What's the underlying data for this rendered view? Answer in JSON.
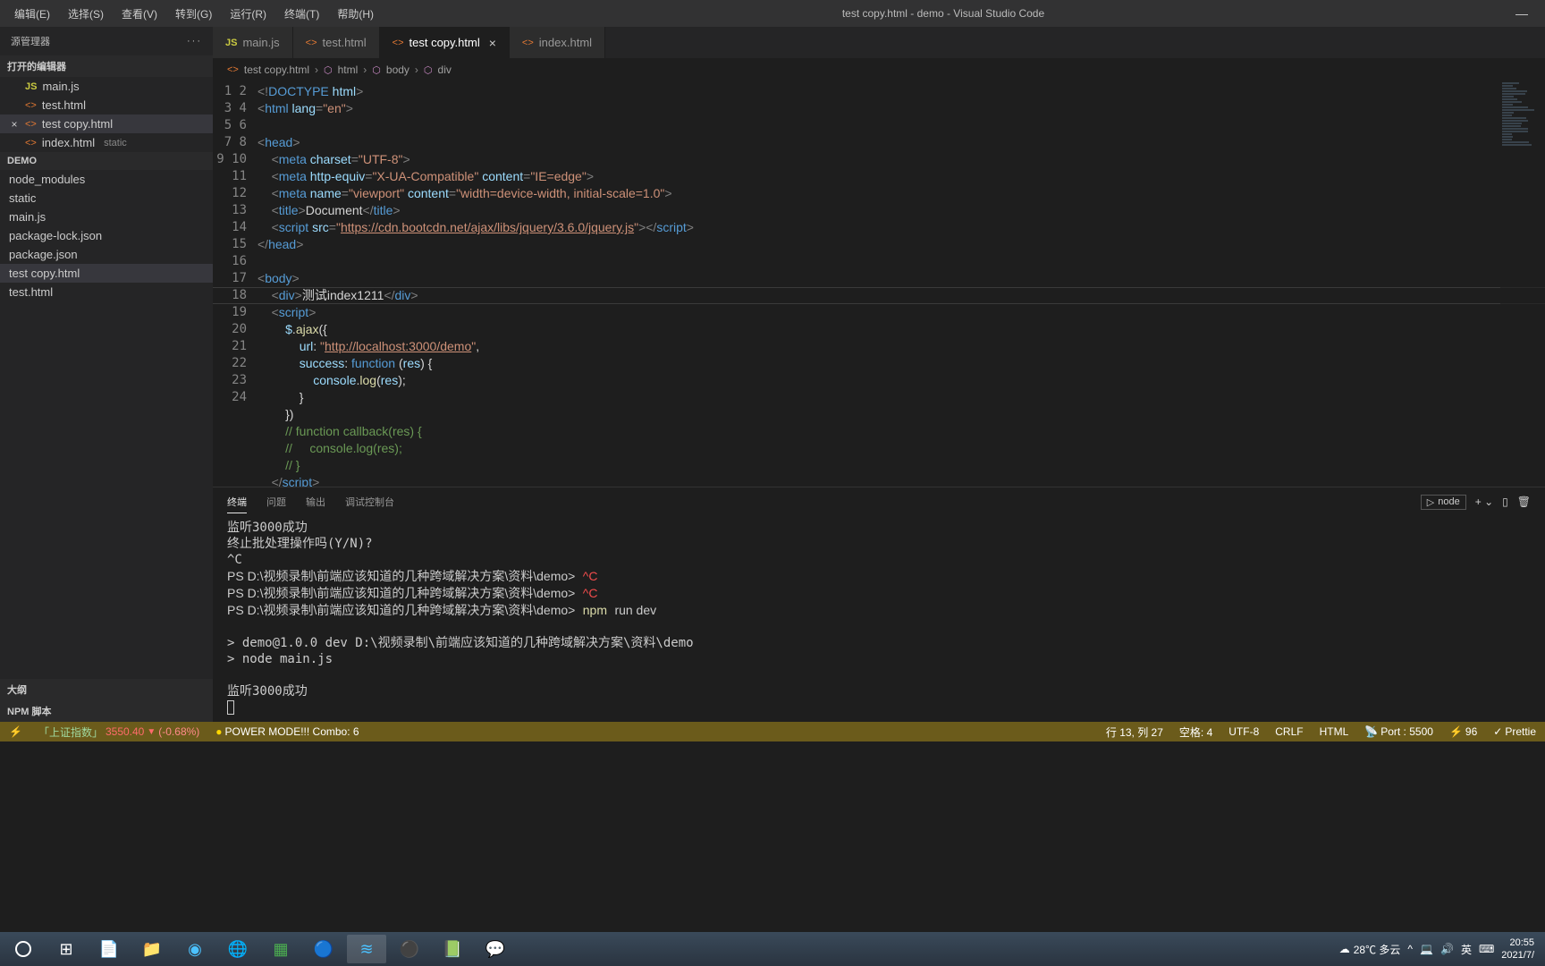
{
  "titlebar": {
    "menus": [
      "编辑(E)",
      "选择(S)",
      "查看(V)",
      "转到(G)",
      "运行(R)",
      "终端(T)",
      "帮助(H)"
    ],
    "title": "test copy.html - demo - Visual Studio Code"
  },
  "sidebar": {
    "explorer_label": "源管理器",
    "open_editors_label": "打开的编辑器",
    "open_editors": [
      {
        "icon": "js",
        "name": "main.js",
        "close": false
      },
      {
        "icon": "html",
        "name": "test.html",
        "close": false
      },
      {
        "icon": "html",
        "name": "test copy.html",
        "close": true,
        "selected": true
      },
      {
        "icon": "html",
        "name": "index.html",
        "static": "static",
        "close": false
      }
    ],
    "demo_label": "DEMO",
    "demo_items": [
      {
        "name": "node_modules"
      },
      {
        "name": "static"
      },
      {
        "name": "main.js"
      },
      {
        "name": "package-lock.json"
      },
      {
        "name": "package.json"
      },
      {
        "name": "test copy.html",
        "selected": true
      },
      {
        "name": "test.html"
      }
    ],
    "outline_label": "大纲",
    "npm_scripts_label": "NPM 脚本"
  },
  "tabs": [
    {
      "icon": "js",
      "label": "main.js"
    },
    {
      "icon": "html",
      "label": "test.html"
    },
    {
      "icon": "html",
      "label": "test copy.html",
      "active": true,
      "close": true
    },
    {
      "icon": "html",
      "label": "index.html"
    }
  ],
  "breadcrumb": [
    {
      "icon": "html",
      "label": "test copy.html"
    },
    {
      "icon": "bc",
      "label": "html"
    },
    {
      "icon": "bc",
      "label": "body"
    },
    {
      "icon": "bc",
      "label": "div"
    }
  ],
  "code": {
    "start_line": 1,
    "lines": 24
  },
  "panel": {
    "tabs": [
      "终端",
      "问题",
      "输出",
      "调试控制台"
    ],
    "active_tab": 0,
    "node_label": "node",
    "output": {
      "l1": "监听3000成功",
      "l2": "终止批处理操作吗(Y/N)?",
      "l3": "^C",
      "ps_prefix": "PS D:\\视频录制\\前端应该知道的几种跨域解决方案\\资料\\demo>",
      "ctrl_c": "^C",
      "npm_cmd": "npm run dev",
      "l4": "> demo@1.0.0 dev D:\\视频录制\\前端应该知道的几种跨域解决方案\\资料\\demo",
      "l5": "> node main.js",
      "l6": "监听3000成功"
    }
  },
  "statusbar": {
    "stock_label": "「上证指数」",
    "stock_val": "3550.40",
    "stock_pct": "(-0.68%)",
    "powermode": "POWER MODE!!! Combo: 6",
    "cursor": "行 13, 列 27",
    "spaces": "空格: 4",
    "encoding": "UTF-8",
    "eol": "CRLF",
    "lang": "HTML",
    "port": "Port : 5500",
    "zap": "96",
    "prettier": "Prettie"
  },
  "taskbar": {
    "weather_temp": "28℃ 多云",
    "ime": "英",
    "time": "20:55",
    "date": "2021/7/"
  }
}
